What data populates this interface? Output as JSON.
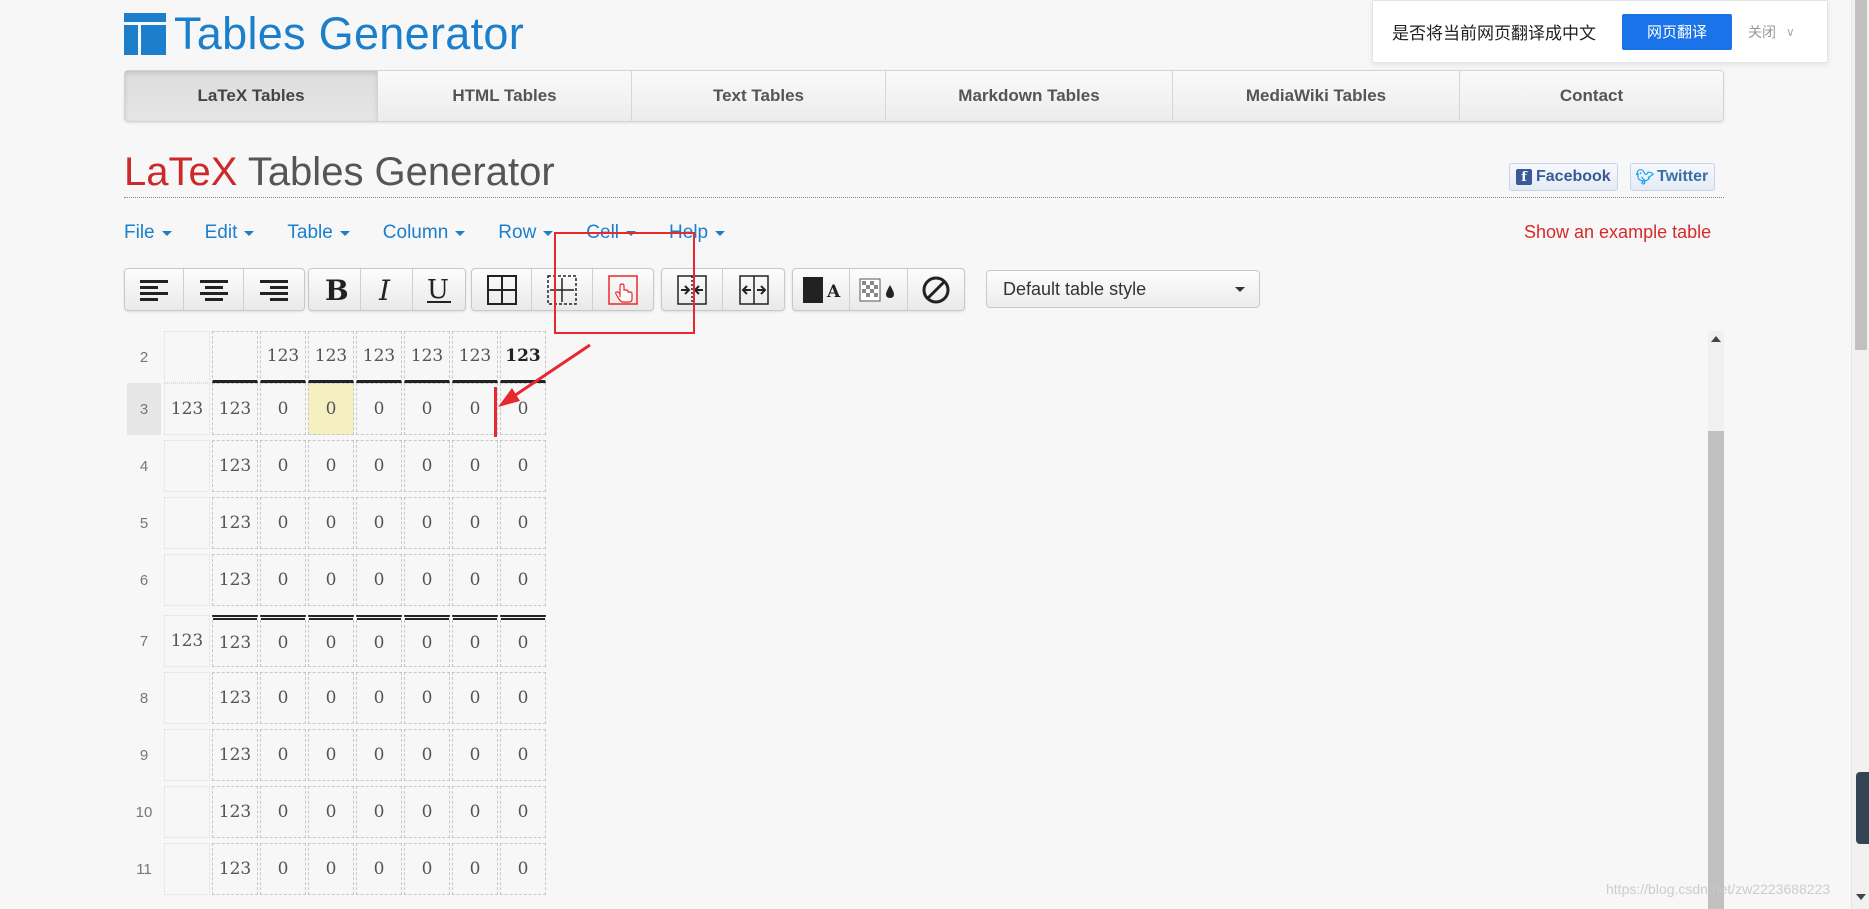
{
  "logo": {
    "text": "Tables Generator"
  },
  "nav": {
    "items": [
      {
        "label": "LaTeX Tables",
        "active": true
      },
      {
        "label": "HTML Tables"
      },
      {
        "label": "Text Tables"
      },
      {
        "label": "Markdown Tables"
      },
      {
        "label": "MediaWiki Tables"
      },
      {
        "label": "Contact"
      }
    ]
  },
  "translate": {
    "question": "是否将当前网页翻译成中文",
    "button": "网页翻译",
    "close": "关闭"
  },
  "heading": {
    "latex": "LaTeX",
    "rest": " Tables Generator"
  },
  "social": {
    "facebook": "Facebook",
    "twitter": "Twitter"
  },
  "menu": {
    "items": [
      "File",
      "Edit",
      "Table",
      "Column",
      "Row",
      "Cell",
      "Help"
    ],
    "example": "Show an example table"
  },
  "toolbar": {
    "style_select": "Default table style"
  },
  "grid": {
    "row_labels": [
      "2",
      "3",
      "4",
      "5",
      "6",
      "7",
      "8",
      "9",
      "10",
      "11"
    ],
    "rows": [
      [
        "",
        "",
        "123",
        "123",
        "123",
        "123",
        "123",
        "123"
      ],
      [
        "123",
        "123",
        "0",
        "0",
        "0",
        "0",
        "0",
        "0"
      ],
      [
        "",
        "123",
        "0",
        "0",
        "0",
        "0",
        "0",
        "0"
      ],
      [
        "",
        "123",
        "0",
        "0",
        "0",
        "0",
        "0",
        "0"
      ],
      [
        "",
        "123",
        "0",
        "0",
        "0",
        "0",
        "0",
        "0"
      ],
      [
        "123",
        "123",
        "0",
        "0",
        "0",
        "0",
        "0",
        "0"
      ],
      [
        "",
        "123",
        "0",
        "0",
        "0",
        "0",
        "0",
        "0"
      ],
      [
        "",
        "123",
        "0",
        "0",
        "0",
        "0",
        "0",
        "0"
      ],
      [
        "",
        "123",
        "0",
        "0",
        "0",
        "0",
        "0",
        "0"
      ],
      [
        "",
        "123",
        "0",
        "0",
        "0",
        "0",
        "0",
        "0"
      ]
    ]
  },
  "watermark": "https://blog.csdn.net/zw2223688223"
}
